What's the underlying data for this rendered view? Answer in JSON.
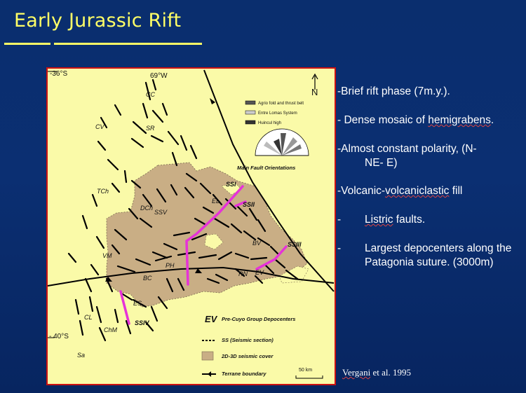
{
  "slide": {
    "title": "Early Jurassic Rift",
    "accent_color": "#ffff66",
    "background_color": "#0a2e6e"
  },
  "bullets": [
    {
      "dash": "-",
      "parts": [
        "Brief rift phase (7m.y.)."
      ]
    },
    {
      "dash": "- ",
      "parts": [
        "Dense mosaic of ",
        "hemigrabens",
        "."
      ]
    },
    {
      "dash": "-",
      "parts": [
        "Almost constant polarity, (N-",
        "NE- E)"
      ]
    },
    {
      "dash": "-",
      "parts": [
        "Volcanic-",
        "volcaniclastic",
        " fill"
      ]
    },
    {
      "dash": "-",
      "parts": [
        "Listric",
        " faults."
      ]
    },
    {
      "dash": "-",
      "parts": [
        "Largest depocenters along the Patagonia suture. (3000m)"
      ]
    }
  ],
  "citation": {
    "author": "Vergani",
    "rest": " et al. 1995"
  },
  "map": {
    "lat_top": "-36°S",
    "lat_bottom": "- 40°S",
    "lon_label": "69°W",
    "north_label": "N",
    "scale_label": "50 km",
    "place_labels": [
      "CC",
      "CV",
      "SR",
      "TCh",
      "SSV",
      "DCh",
      "EL",
      "VM",
      "PH",
      "BC",
      "RN",
      "BV",
      "EV",
      "ES",
      "CL",
      "ChM",
      "Sa"
    ],
    "section_labels": [
      "SSI",
      "SSII",
      "SSIII",
      "SSIV"
    ],
    "rose_legend": [
      {
        "label": "Agrio fold and thrust belt",
        "color": "#555555"
      },
      {
        "label": "Entre Lomas System",
        "color": "#cccccc"
      },
      {
        "label": "Huincul high",
        "color": "#333333"
      }
    ],
    "rose_title": "Main Fault Orientations",
    "legend": {
      "ev_code": "EV",
      "ev_text": "Pre-Cuyo Group Depocenters",
      "ss_text": "SS (Seismic section)",
      "cover_text": "2D-3D seismic cover",
      "terrane_text": "Terrane boundary"
    },
    "colors": {
      "map_bg": "#fafaa8",
      "seismic_cover": "#c9ae85",
      "section_line": "#e632d8",
      "fault": "#000000",
      "frame": "#cc1111"
    }
  }
}
